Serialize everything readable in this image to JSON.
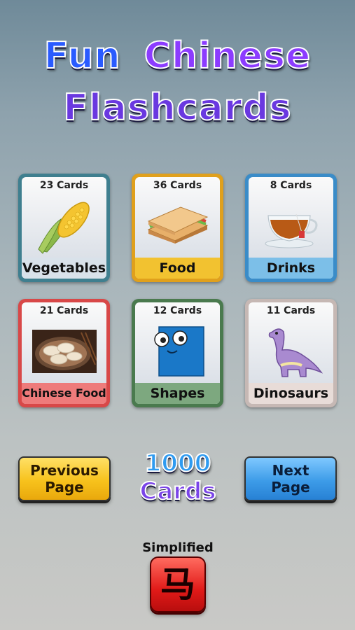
{
  "title": {
    "line1": [
      "Fun",
      "Chinese"
    ],
    "line2": [
      "Flashcards"
    ],
    "colors": {
      "fun": "#2a5bff",
      "chinese": "#8c3cff",
      "flash": "#6a38e0"
    }
  },
  "categories": [
    {
      "count": "23 Cards",
      "label": "Vegetables",
      "icon": "corn-icon",
      "border": "#3f7f8f",
      "band": "#d9e2ea"
    },
    {
      "count": "36 Cards",
      "label": "Food",
      "icon": "sandwich-icon",
      "border": "#e0a01c",
      "band": "#f2c230"
    },
    {
      "count": "8 Cards",
      "label": "Drinks",
      "icon": "tea-cup-icon",
      "border": "#3a8cc8",
      "band": "#7cbfe8"
    },
    {
      "count": "21 Cards",
      "label": "Chinese Food",
      "icon": "dumplings-image",
      "border": "#d84848",
      "band": "#ee7b7b"
    },
    {
      "count": "12 Cards",
      "label": "Shapes",
      "icon": "square-face-icon",
      "border": "#4a7a4e",
      "band": "#7da87f"
    },
    {
      "count": "11 Cards",
      "label": "Dinosaurs",
      "icon": "dinosaur-icon",
      "border": "#c6b8b4",
      "band": "#e8dcd8"
    }
  ],
  "nav": {
    "previous_line1": "Previous",
    "previous_line2": "Page",
    "next_line1": "Next",
    "next_line2": "Page"
  },
  "total": {
    "line1": "1000",
    "line2": "Cards"
  },
  "script_mode": {
    "label": "Simplified",
    "glyph": "马"
  }
}
